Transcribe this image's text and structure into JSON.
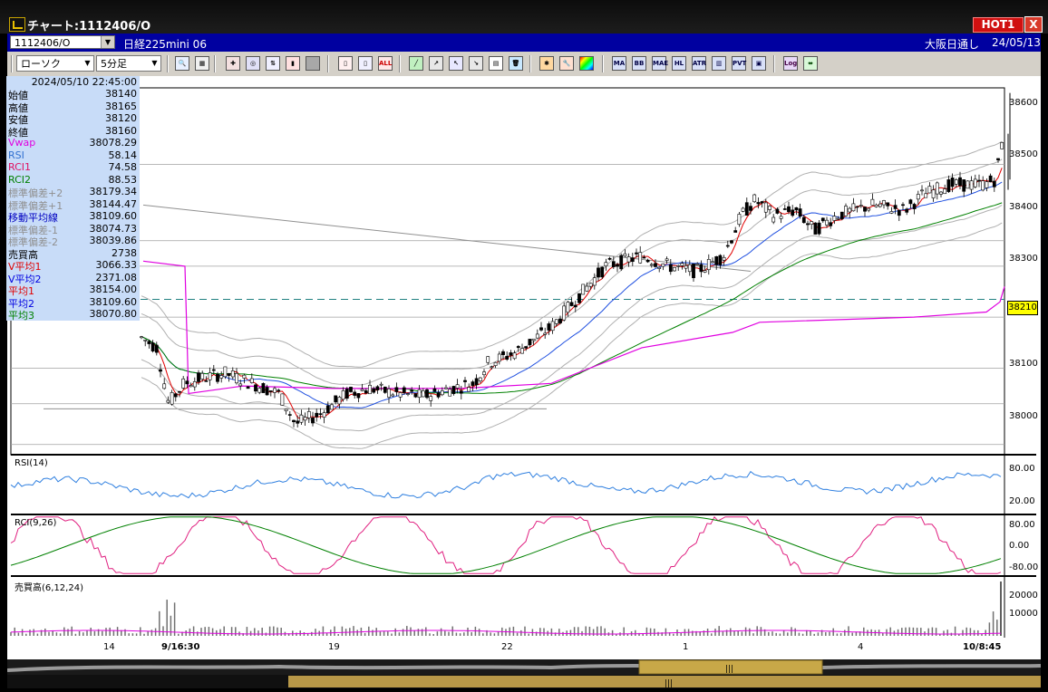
{
  "window": {
    "title": "チャート:1112406/O",
    "hot_label": "HOT1",
    "close_label": "X"
  },
  "symbolbar": {
    "symbol": "1112406/O",
    "name": "日経225mini 06",
    "market": "大阪日通し",
    "date": "24/05/13"
  },
  "toolbar": {
    "chart_type": "ローソク",
    "interval": "5分足",
    "buttons": [
      "ALL",
      "MA",
      "BB",
      "MAE",
      "HL",
      "ATR",
      "PVT",
      "Log"
    ]
  },
  "info": {
    "datetime": "2024/05/10 22:45:00",
    "rows": [
      {
        "k": "始値",
        "v": "38140",
        "color": "#000000"
      },
      {
        "k": "高値",
        "v": "38165",
        "color": "#000000"
      },
      {
        "k": "安値",
        "v": "38120",
        "color": "#000000"
      },
      {
        "k": "終値",
        "v": "38160",
        "color": "#000000"
      },
      {
        "k": "Vwap",
        "v": "38078.29",
        "color": "#e000e0"
      },
      {
        "k": "RSI",
        "v": "58.14",
        "color": "#3070d0"
      },
      {
        "k": "RCI1",
        "v": "74.58",
        "color": "#e01060"
      },
      {
        "k": "RCI2",
        "v": "88.53",
        "color": "#008000"
      },
      {
        "k": "標準偏差+2",
        "v": "38179.34",
        "color": "#909090"
      },
      {
        "k": "標準偏差+1",
        "v": "38144.47",
        "color": "#909090"
      },
      {
        "k": "移動平均線",
        "v": "38109.60",
        "color": "#0000c0"
      },
      {
        "k": "標準偏差-1",
        "v": "38074.73",
        "color": "#909090"
      },
      {
        "k": "標準偏差-2",
        "v": "38039.86",
        "color": "#909090"
      },
      {
        "k": "売買高",
        "v": "2738",
        "color": "#000000"
      },
      {
        "k": "V平均1",
        "v": "3066.33",
        "color": "#e00000"
      },
      {
        "k": "V平均2",
        "v": "2371.08",
        "color": "#0000e0"
      },
      {
        "k": "平均1",
        "v": "38154.00",
        "color": "#e00000"
      },
      {
        "k": "平均2",
        "v": "38109.60",
        "color": "#0000e0"
      },
      {
        "k": "平均3",
        "v": "38070.80",
        "color": "#008000"
      }
    ]
  },
  "price_axis": [
    "38600",
    "38500",
    "38400",
    "38300",
    "38100",
    "38000"
  ],
  "current_price": "38210",
  "rsi": {
    "label": "RSI(14)",
    "ticks": [
      "80.00",
      "20.00"
    ]
  },
  "rci": {
    "label": "RCI(9,26)",
    "ticks": [
      "80.00",
      "0.00",
      "-80.00"
    ]
  },
  "volume": {
    "label": "売買高(6,12,24)",
    "ticks": [
      "20000",
      "10000"
    ]
  },
  "time_axis": [
    "14",
    "9/16:30",
    "19",
    "22",
    "1",
    "4",
    "10/8:45"
  ],
  "chart_data": {
    "type": "candlestick",
    "ylim": [
      37930,
      38650
    ],
    "series_names": [],
    "current_price": 38210
  }
}
